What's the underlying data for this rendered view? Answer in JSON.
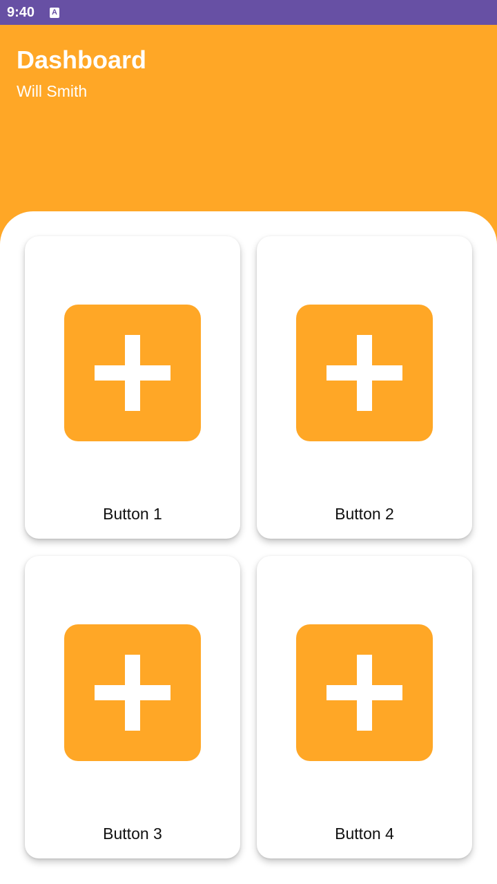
{
  "status_bar": {
    "time": "9:40",
    "notification_glyph": "A",
    "notification_icon": "app-notification-icon"
  },
  "header": {
    "title": "Dashboard",
    "subtitle": "Will Smith"
  },
  "cards": [
    {
      "label": "Button 1",
      "icon": "plus-icon"
    },
    {
      "label": "Button 2",
      "icon": "plus-icon"
    },
    {
      "label": "Button 3",
      "icon": "plus-icon"
    },
    {
      "label": "Button 4",
      "icon": "plus-icon"
    }
  ],
  "colors": {
    "status_bar": "#6750a4",
    "header": "#ffa726",
    "icon_tile": "#ffa726",
    "icon_glyph": "#ffffff",
    "card": "#ffffff"
  }
}
